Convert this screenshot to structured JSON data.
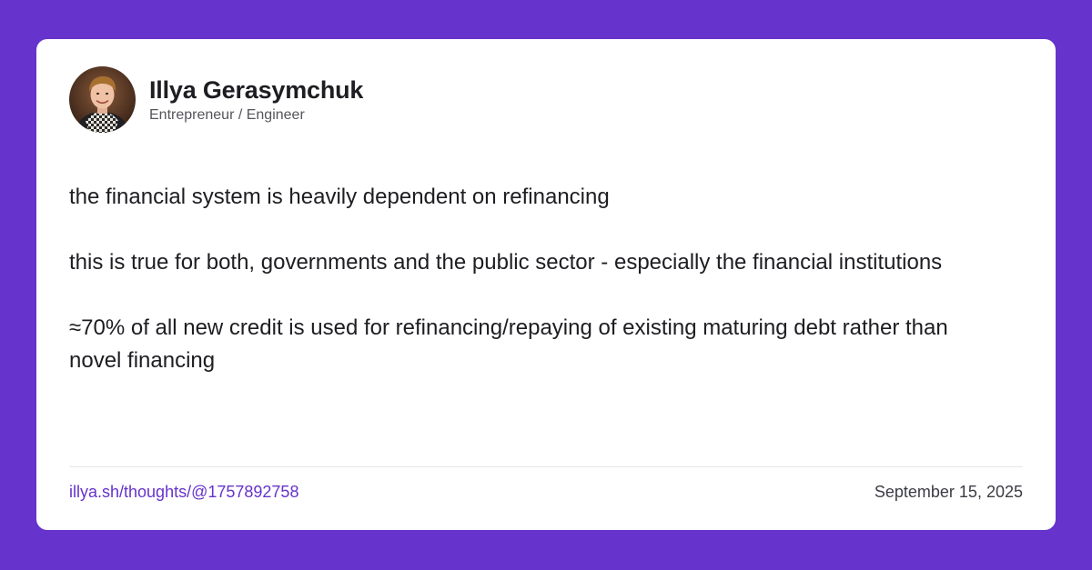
{
  "author": {
    "name": "Illya Gerasymchuk",
    "title": "Entrepreneur / Engineer"
  },
  "post": {
    "paragraphs": [
      "the financial system is heavily dependent on refinancing",
      "this is true for both, governments and the public sector - especially the financial institutions",
      "≈70% of all new credit is used for refinancing/repaying of existing maturing debt rather than novel financing"
    ]
  },
  "footer": {
    "link_text": "illya.sh/thoughts/@1757892758",
    "date": "September 15, 2025"
  },
  "colors": {
    "background": "#6633cc",
    "card": "#ffffff",
    "link": "#6633cc",
    "text": "#1d1d22"
  }
}
